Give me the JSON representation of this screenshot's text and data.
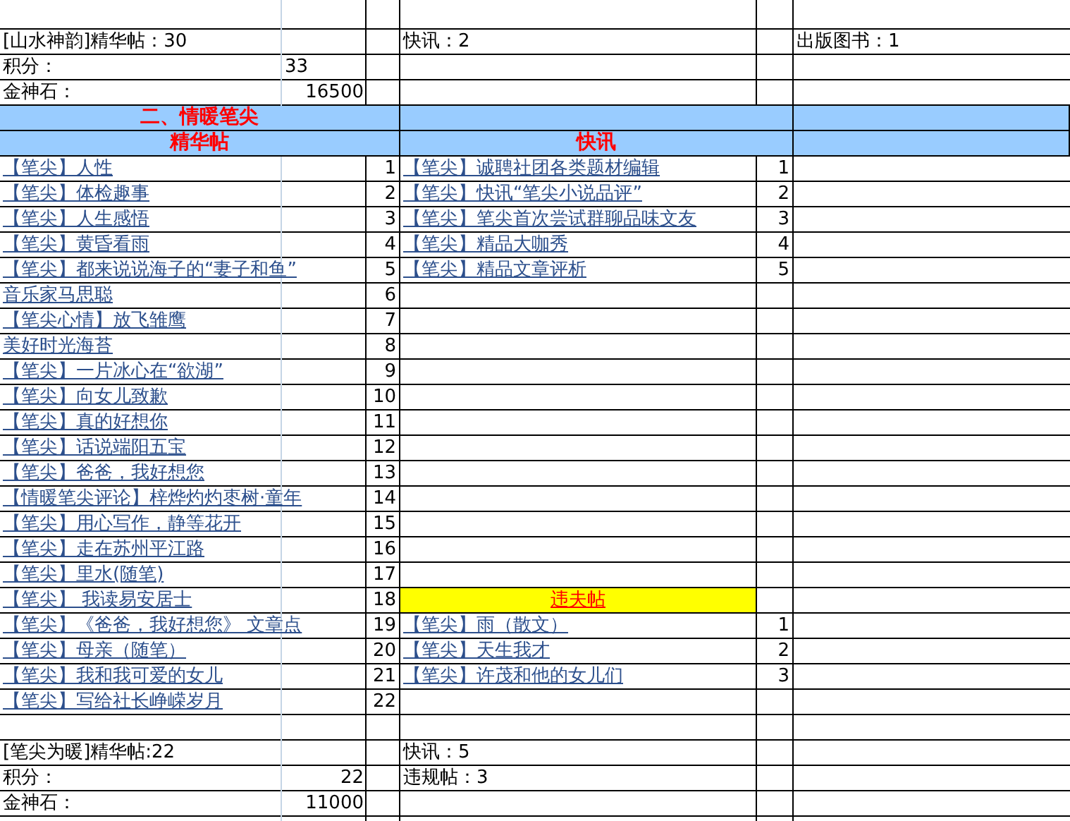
{
  "top_summary": {
    "essence": "[山水神韵]精华帖：30",
    "flash": "快讯：2",
    "books": "出版图书：1",
    "points_label": "积分：",
    "points": "33",
    "stones_label": "金神石：",
    "stones": "16500"
  },
  "section": {
    "title": "二、情暖笔尖",
    "essence_header": "精华帖",
    "flash_header": "快讯"
  },
  "essence_posts": [
    {
      "title": "【笔尖】人性",
      "number": "1"
    },
    {
      "title": "【笔尖】体检趣事",
      "number": "2"
    },
    {
      "title": "【笔尖】人生感悟",
      "number": "3"
    },
    {
      "title": "【笔尖】黄昏看雨",
      "number": "4"
    },
    {
      "title": "【笔尖】都来说说海子的“妻子和鱼”",
      "number": "5"
    },
    {
      "title": "音乐家马思聪",
      "number": "6"
    },
    {
      "title": "【笔尖心情】放飞雏鹰",
      "number": "7"
    },
    {
      "title": "美好时光海苔",
      "number": "8"
    },
    {
      "title": "【笔尖】一片冰心在“欲湖”",
      "number": "9"
    },
    {
      "title": "【笔尖】向女儿致歉",
      "number": "10"
    },
    {
      "title": "【笔尖】真的好想你",
      "number": "11"
    },
    {
      "title": "【笔尖】话说端阳五宝",
      "number": "12"
    },
    {
      "title": "【笔尖】爸爸，我好想您",
      "number": "13"
    },
    {
      "title": "【情暖笔尖评论】梓烨灼灼枣树·童年",
      "number": "14"
    },
    {
      "title": "【笔尖】用心写作，静等花开",
      "number": "15"
    },
    {
      "title": "【笔尖】走在苏州平江路",
      "number": "16"
    },
    {
      "title": "【笔尖】里水(随笔)",
      "number": "17"
    },
    {
      "title": "【笔尖】  我读易安居士",
      "number": "18"
    },
    {
      "title": "【笔尖】《爸爸，我好想您》 文章点",
      "number": "19"
    },
    {
      "title": "【笔尖】母亲（随笔）",
      "number": "20"
    },
    {
      "title": "【笔尖】我和我可爱的女儿",
      "number": "21"
    },
    {
      "title": "【笔尖】写给社长峥嵘岁月",
      "number": "22"
    }
  ],
  "flash_posts": [
    {
      "title": "【笔尖】诚聘社团各类题材编辑",
      "number": "1"
    },
    {
      "title": "【笔尖】快讯“笔尖小说品评”",
      "number": "2"
    },
    {
      "title": "【笔尖】笔尖首次尝试群聊品味文友",
      "number": "3"
    },
    {
      "title": "【笔尖】精品大咖秀",
      "number": "4"
    },
    {
      "title": "【笔尖】精品文章评析",
      "number": "5"
    }
  ],
  "violation_header": "违夫帖",
  "violation_posts": [
    {
      "title": "【笔尖】雨（散文）",
      "number": "1"
    },
    {
      "title": "【笔尖】天生我才",
      "number": "2"
    },
    {
      "title": "【笔尖】许茂和他的女儿们",
      "number": "3"
    }
  ],
  "bottom_summary": {
    "essence": "[笔尖为暖]精华帖:22",
    "flash": "快讯：5",
    "violations": "违规帖：3",
    "points_label": "积分：",
    "points": "22",
    "stones_label": "金神石：",
    "stones": "11000"
  }
}
